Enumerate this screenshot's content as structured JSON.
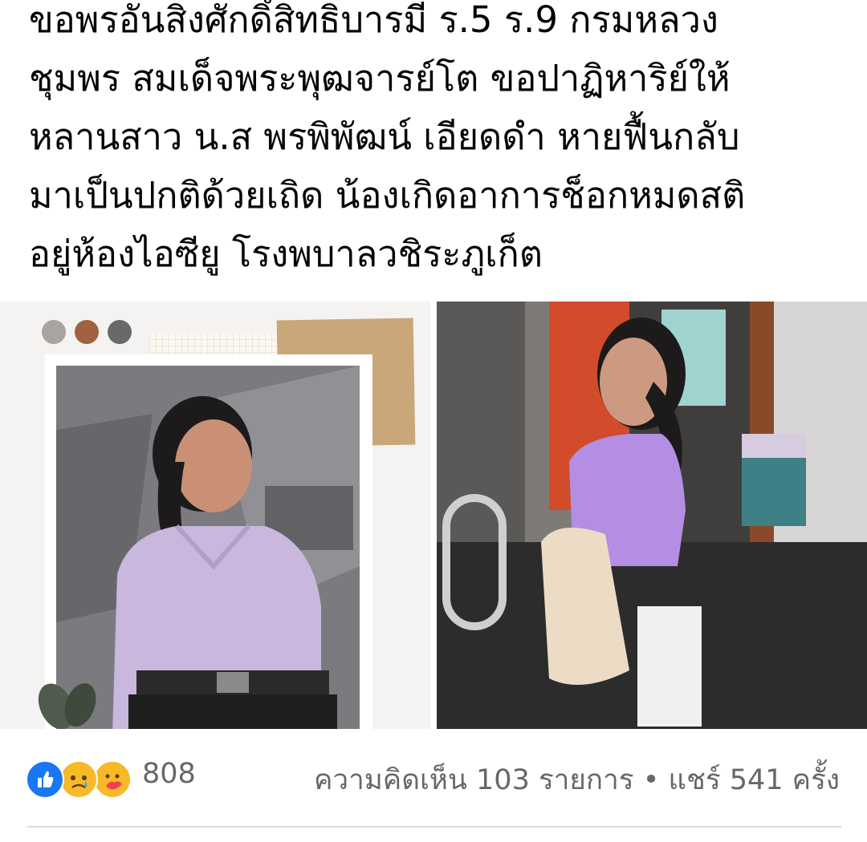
{
  "post": {
    "text_lines": [
      "ขอพรอันสิ่งศักดิ์สิทธิบารมี ร.5 ร.9 กรมหลวง",
      "ชุมพร สมเด็จพระพุฒจารย์โต ขอปาฏิหาริย์ให้",
      "หลานสาว น.ส พรพิพัฒน์ เอียดดำ หายฟื้นกลับ",
      "มาเป็นปกติด้วยเถิด น้องเกิดอาการช็อกหมดสติ",
      "อยู่ห้องไอซียู โรงพบาลวชิระภูเก็ต"
    ]
  },
  "photos": {
    "left_photo_icon": "photo-collage-portrait",
    "right_photo_icon": "photo-hallway-portrait"
  },
  "reactions": {
    "icons": [
      "like-icon",
      "sad-icon",
      "care-icon"
    ],
    "count": "808",
    "comments_label": "ความคิดเห็น 103 รายการ",
    "separator": "•",
    "shares_label": "แชร์ 541 ครั้ง"
  },
  "colors": {
    "like_blue": "#1877f2",
    "sad_yellow": "#f7b928",
    "care_red": "#f33e58",
    "meta_text": "#65676b"
  }
}
